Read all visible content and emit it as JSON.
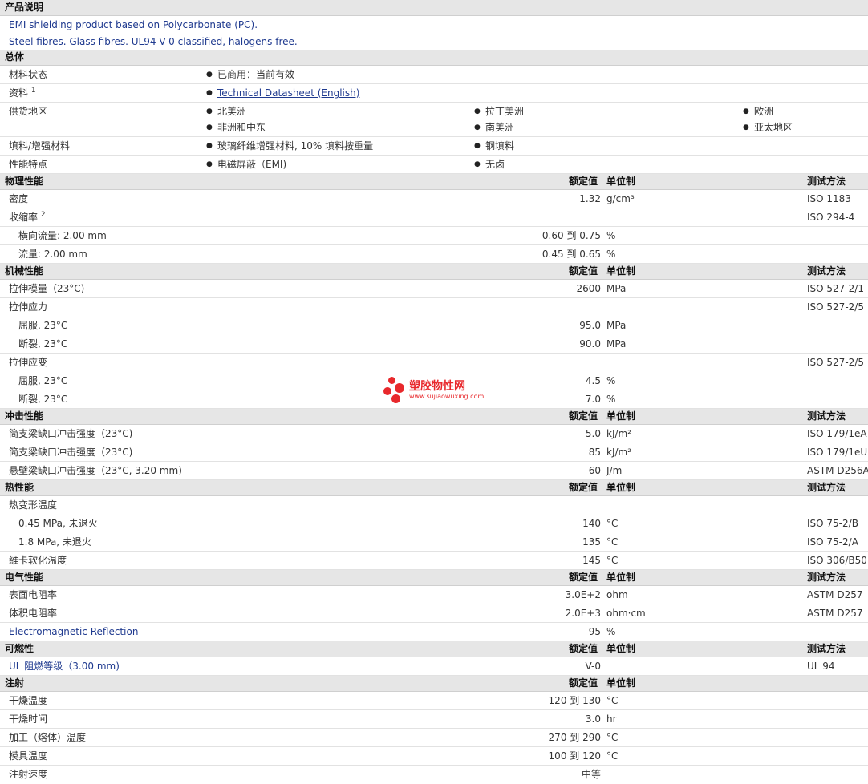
{
  "desc": {
    "title": "产品说明",
    "line1": "EMI shielding product based on Polycarbonate (PC).",
    "line2": "Steel fibres. Glass fibres. UL94 V-0 classified, halogens free."
  },
  "general": {
    "title": "总体",
    "material_status_label": "材料状态",
    "material_status_value": "已商用：当前有效",
    "docs_label": "资料",
    "docs_sup": "1",
    "docs_link": "Technical Datasheet (English)",
    "supply_label": "供货地区",
    "regions": [
      "北美洲",
      "拉丁美洲",
      "欧洲",
      "非洲和中东",
      "南美洲",
      "亚太地区"
    ],
    "filler_label": "填料/增强材料",
    "fillers": [
      "玻璃纤维增强材料, 10% 填料按重量",
      "钢填料"
    ],
    "features_label": "性能特点",
    "features": [
      "电磁屏蔽（EMI)",
      "无卤"
    ]
  },
  "headers": {
    "value": "额定值",
    "unit": "单位制",
    "method": "测试方法"
  },
  "physical": {
    "title": "物理性能",
    "density_label": "密度",
    "density_value": "1.32",
    "density_unit": "g/cm³",
    "density_method": "ISO 1183",
    "shrink_label": "收缩率",
    "shrink_sup": "2",
    "shrink_method": "ISO 294-4",
    "shrink_cross_label": "横向流量: 2.00 mm",
    "shrink_cross_value": "0.60 到 0.75",
    "shrink_cross_unit": "%",
    "shrink_flow_label": "流量: 2.00 mm",
    "shrink_flow_value": "0.45 到 0.65",
    "shrink_flow_unit": "%"
  },
  "mechanical": {
    "title": "机械性能",
    "tm_label": "拉伸模量（23°C)",
    "tm_value": "2600",
    "tm_unit": "MPa",
    "tm_method": "ISO 527-2/1",
    "ts_label": "拉伸应力",
    "ts_method": "ISO 527-2/5",
    "ts_yield_label": "屈服, 23°C",
    "ts_yield_value": "95.0",
    "ts_yield_unit": "MPa",
    "ts_break_label": "断裂, 23°C",
    "ts_break_value": "90.0",
    "ts_break_unit": "MPa",
    "te_label": "拉伸应变",
    "te_method": "ISO 527-2/5",
    "te_yield_label": "屈服, 23°C",
    "te_yield_value": "4.5",
    "te_yield_unit": "%",
    "te_break_label": "断裂, 23°C",
    "te_break_value": "7.0",
    "te_break_unit": "%"
  },
  "impact": {
    "title": "冲击性能",
    "r1_label": "简支梁缺口冲击强度（23°C)",
    "r1_value": "5.0",
    "r1_unit": "kJ/m²",
    "r1_method": "ISO 179/1eA",
    "r2_label": "简支梁缺口冲击强度（23°C)",
    "r2_value": "85",
    "r2_unit": "kJ/m²",
    "r2_method": "ISO 179/1eU",
    "r3_label": "悬壁梁缺口冲击强度（23°C, 3.20 mm)",
    "r3_value": "60",
    "r3_unit": "J/m",
    "r3_method": "ASTM D256A"
  },
  "thermal": {
    "title": "热性能",
    "hdt_label": "热变形温度",
    "hdt1_label": "0.45 MPa, 未退火",
    "hdt1_value": "140",
    "hdt1_unit": "°C",
    "hdt1_method": "ISO 75-2/B",
    "hdt2_label": "1.8 MPa, 未退火",
    "hdt2_value": "135",
    "hdt2_unit": "°C",
    "hdt2_method": "ISO 75-2/A",
    "vicat_label": "維卡软化温度",
    "vicat_value": "145",
    "vicat_unit": "°C",
    "vicat_method": "ISO 306/B50"
  },
  "electrical": {
    "title": "电气性能",
    "sr_label": "表面电阻率",
    "sr_value": "3.0E+2",
    "sr_unit": "ohm",
    "sr_method": "ASTM D257",
    "vr_label": "体积电阻率",
    "vr_value": "2.0E+3",
    "vr_unit": "ohm·cm",
    "vr_method": "ASTM D257",
    "emr_label": "Electromagnetic Reflection",
    "emr_value": "95",
    "emr_unit": "%"
  },
  "flammability": {
    "title": "可燃性",
    "ul_label": "UL 阻燃等级（3.00 mm)",
    "ul_value": "V-0",
    "ul_method": "UL 94"
  },
  "injection": {
    "title": "注射",
    "dt_label": "干燥温度",
    "dt_value": "120 到 130",
    "dt_unit": "°C",
    "dtime_label": "干燥时间",
    "dtime_value": "3.0",
    "dtime_unit": "hr",
    "mt_label": "加工（熔体）温度",
    "mt_value": "270 到 290",
    "mt_unit": "°C",
    "mold_label": "模具温度",
    "mold_value": "100 到 120",
    "mold_unit": "°C",
    "speed_label": "注射速度",
    "speed_value": "中等"
  },
  "watermark": {
    "title": "塑胶物性网",
    "url": "www.sujiaowuxing.com"
  }
}
